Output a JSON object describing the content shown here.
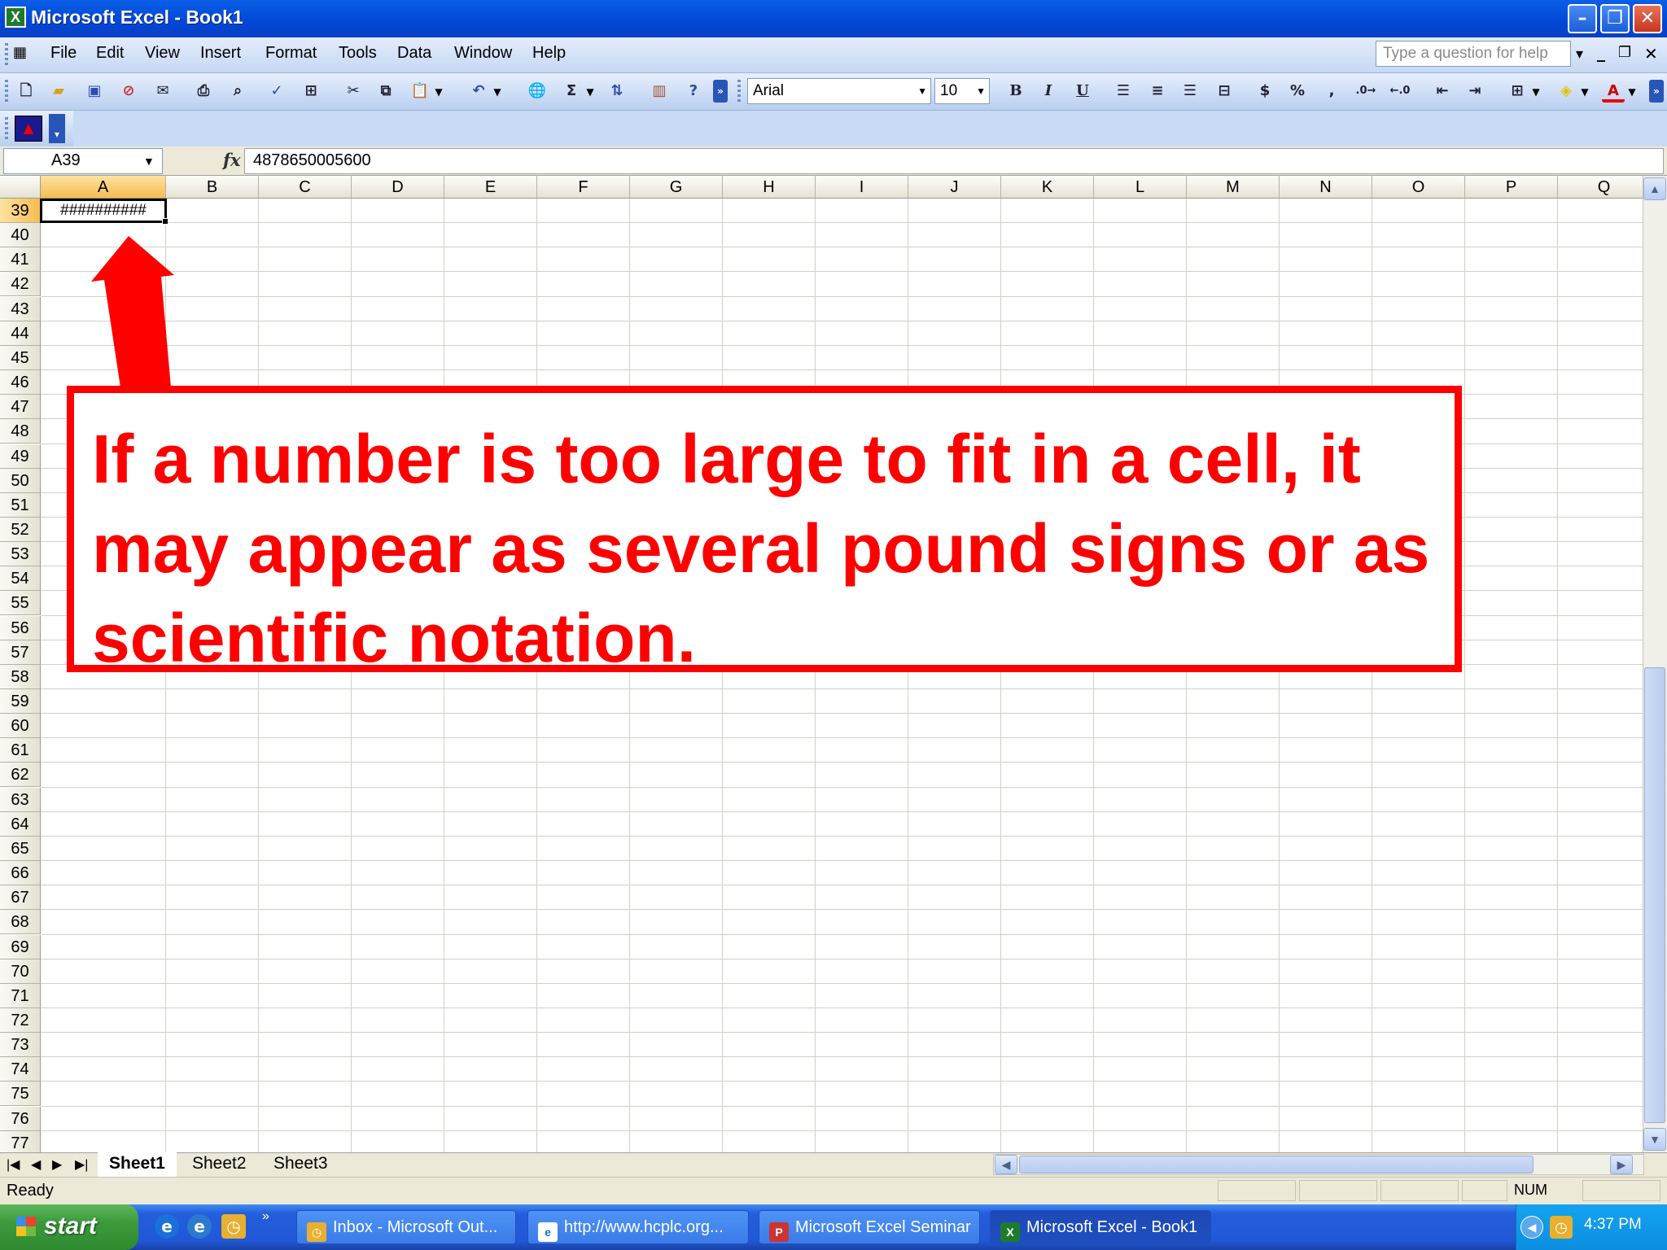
{
  "window": {
    "title": "Microsoft Excel - Book1"
  },
  "menu": {
    "items": [
      "File",
      "Edit",
      "View",
      "Insert",
      "Format",
      "Tools",
      "Data",
      "Window",
      "Help"
    ],
    "help_placeholder": "Type a question for help"
  },
  "toolbar": {
    "font_name": "Arial",
    "font_size": "10",
    "bold": "B",
    "italic": "I",
    "underline": "U",
    "currency": "$",
    "percent": "%",
    "comma": ",",
    "autosum": "Σ"
  },
  "formula_bar": {
    "name_box": "A39",
    "fx": "fx",
    "formula": "4878650005600"
  },
  "grid": {
    "columns": [
      "A",
      "B",
      "C",
      "D",
      "E",
      "F",
      "G",
      "H",
      "I",
      "J",
      "K",
      "L",
      "M",
      "N",
      "O",
      "P",
      "Q"
    ],
    "rows": [
      "39",
      "40",
      "41",
      "42",
      "43",
      "44",
      "45",
      "46",
      "47",
      "48",
      "49",
      "50",
      "51",
      "52",
      "53",
      "54",
      "55",
      "56",
      "57",
      "58",
      "59",
      "60",
      "61",
      "62",
      "63",
      "64",
      "65",
      "66",
      "67",
      "68",
      "69",
      "70",
      "71",
      "72",
      "73",
      "74",
      "75",
      "76",
      "77"
    ],
    "selected_column": "A",
    "selected_row": "39",
    "active_cell_display": "##########"
  },
  "sheets": {
    "tabs": [
      "Sheet1",
      "Sheet2",
      "Sheet3"
    ],
    "active": "Sheet1"
  },
  "status": {
    "ready": "Ready",
    "num": "NUM"
  },
  "taskbar": {
    "start": "start",
    "tasks": [
      "Inbox - Microsoft Out...",
      "http://www.hcplc.org...",
      "Microsoft Excel Seminar",
      "Microsoft Excel - Book1"
    ],
    "clock": "4:37 PM"
  },
  "annotation": {
    "text": "If a number is too large to fit in a cell, it may appear as several pound signs or as scientific notation.",
    "color": "#ff0000"
  }
}
